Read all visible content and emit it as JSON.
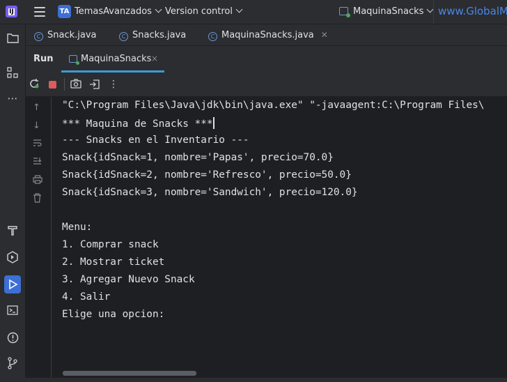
{
  "titlebar": {
    "logo_text": "IJ",
    "project_badge": "TA",
    "project_name": "TemasAvanzados",
    "vcs_label": "Version control",
    "run_config": "MaquinaSnacks",
    "url_text": "www.GlobalM"
  },
  "editor_tabs": [
    {
      "label": "Snack.java",
      "icon": "java-class-icon"
    },
    {
      "label": "Snacks.java",
      "icon": "java-class-icon"
    },
    {
      "label": "MaquinaSnacks.java",
      "icon": "java-class-icon",
      "closable": true
    }
  ],
  "run_panel": {
    "label": "Run",
    "tab_label": "MaquinaSnacks",
    "close_glyph": "×"
  },
  "console": {
    "lines": [
      "\"C:\\Program Files\\Java\\jdk\\bin\\java.exe\" \"-javaagent:C:\\Program Files\\",
      "*** Maquina de Snacks ***",
      "--- Snacks en el Inventario ---",
      "Snack{idSnack=1, nombre='Papas', precio=70.0}",
      "Snack{idSnack=2, nombre='Refresco', precio=50.0}",
      "Snack{idSnack=3, nombre='Sandwich', precio=120.0}",
      "",
      "Menu:",
      "1. Comprar snack",
      "2. Mostrar ticket",
      "3. Agregar Nuevo Snack",
      "4. Salir",
      "Elige una opcion:"
    ]
  },
  "colors": {
    "accent": "#3d6fd6",
    "tab_underline": "#3d9bd6",
    "stop": "#db5c5c",
    "link": "#4a86e8"
  }
}
